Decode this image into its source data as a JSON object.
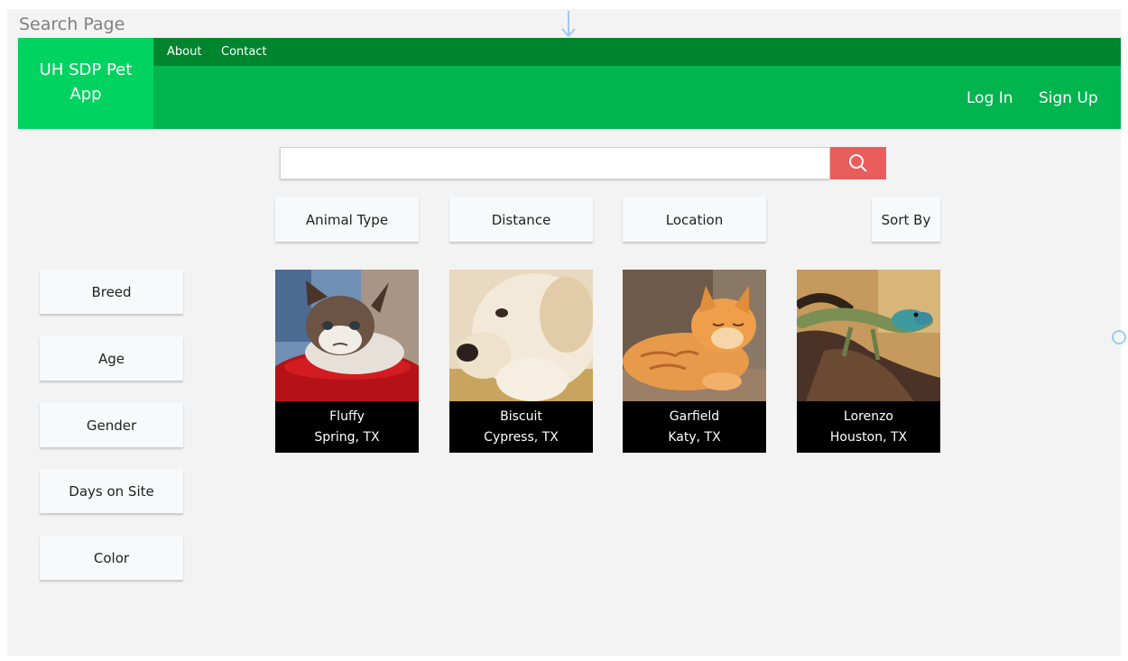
{
  "artboard": {
    "label": "Search Page"
  },
  "header": {
    "brand": {
      "line1": "UH SDP Pet",
      "line2": "App"
    },
    "nav": [
      {
        "label": "About"
      },
      {
        "label": "Contact"
      }
    ],
    "auth": {
      "login": "Log In",
      "signup": "Sign Up"
    }
  },
  "search": {
    "value": "",
    "placeholder": ""
  },
  "filters": [
    {
      "label": "Animal Type"
    },
    {
      "label": "Distance"
    },
    {
      "label": "Location"
    },
    {
      "label": "Sort By"
    }
  ],
  "sidebar": [
    {
      "label": "Breed"
    },
    {
      "label": "Age"
    },
    {
      "label": "Gender"
    },
    {
      "label": "Days on Site"
    },
    {
      "label": "Color"
    }
  ],
  "pets": [
    {
      "name": "Fluffy",
      "location": "Spring, TX"
    },
    {
      "name": "Biscuit",
      "location": "Cypress, TX"
    },
    {
      "name": "Garfield",
      "location": "Katy, TX"
    },
    {
      "name": "Lorenzo",
      "location": "Houston, TX"
    }
  ],
  "colors": {
    "brand": "#00d35f",
    "topbar": "#00852f",
    "mainbar": "#00b44e",
    "search_button": "#e95d5d",
    "canvas": "#f3f3f3"
  },
  "icons": {
    "search": "search-icon",
    "frame_arrow": "arrow-down-icon",
    "frame_handle": "circle-handle-icon"
  }
}
